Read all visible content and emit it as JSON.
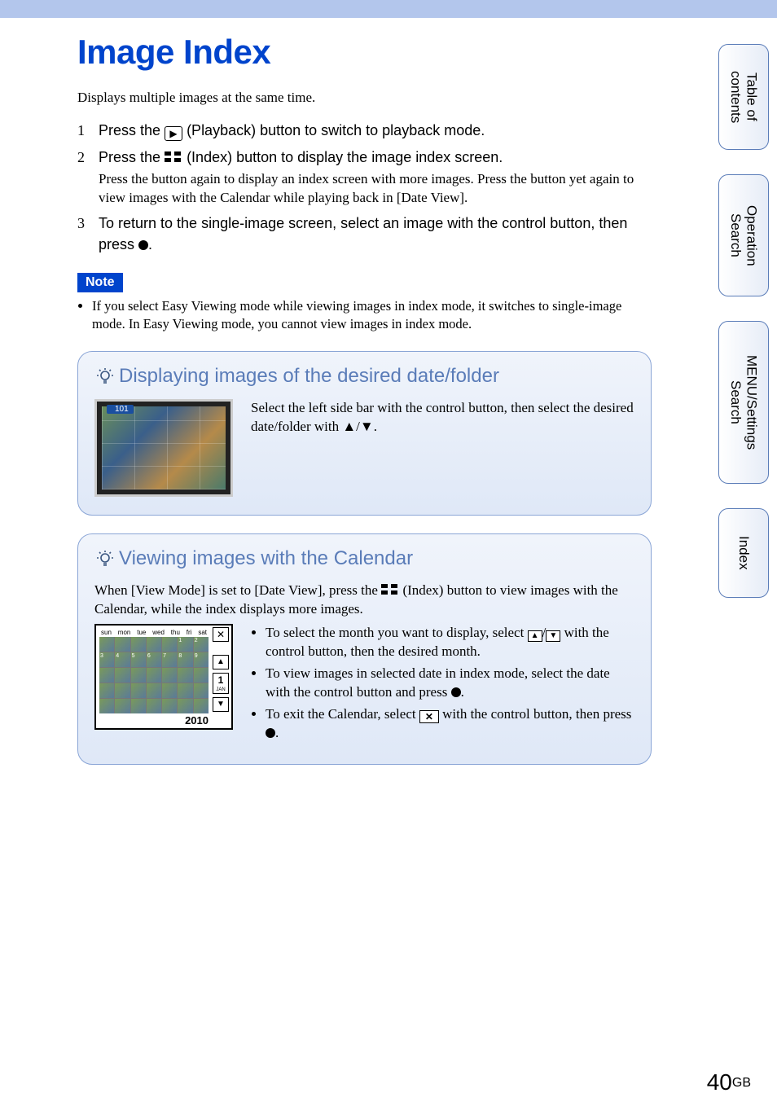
{
  "page_title": "Image Index",
  "intro": "Displays multiple images at the same time.",
  "steps": [
    {
      "num": "1",
      "pre": "Press the ",
      "icon": "playback",
      "post": " (Playback) button to switch to playback mode.",
      "sub": ""
    },
    {
      "num": "2",
      "pre": "Press the ",
      "icon": "index",
      "post": " (Index) button to display the image index screen.",
      "sub": "Press the button again to display an index screen with more images. Press the button yet again to view images with the Calendar while playing back in [Date View]."
    },
    {
      "num": "3",
      "pre": "To return to the single-image screen, select an image with the control button, then press ",
      "icon": "center",
      "post": ".",
      "sub": ""
    }
  ],
  "note_label": "Note",
  "note_bullet": "If you select Easy Viewing mode while viewing images in index mode, it switches to single-image mode. In Easy Viewing mode, you cannot view images in index mode.",
  "tip1": {
    "title": "Displaying images of the desired date/folder",
    "text_pre": "Select the left side bar with the control button, then select the desired date/folder with ",
    "arrows": "▲/▼",
    "text_post": "."
  },
  "tip2": {
    "title": "Viewing images with the Calendar",
    "intro_pre": "When [View Mode] is set to [Date View], press the ",
    "intro_post": " (Index) button to view images with the Calendar, while the index displays more images.",
    "bullets": [
      {
        "pre": "To select the month you want to display, select ",
        "mid": "/",
        "post": " with the control button, then the desired month."
      },
      {
        "pre": "To view images in selected date in index mode, select the date with the control button and press ",
        "icon": "center",
        "post": "."
      },
      {
        "pre": "To exit the Calendar, select ",
        "icon": "x",
        "post": " with the control button, then press ",
        "icon2": "center",
        "post2": "."
      }
    ],
    "calendar": {
      "dow": [
        "sun",
        "mon",
        "tue",
        "wed",
        "thu",
        "fri",
        "sat"
      ],
      "day_num": "1",
      "day_mon": "JAN",
      "year": "2010"
    }
  },
  "side_tabs": {
    "toc": "Table of contents",
    "op": "Operation Search",
    "menu": "MENU/Settings Search",
    "idx": "Index"
  },
  "page_number": "40",
  "page_suffix": "GB"
}
